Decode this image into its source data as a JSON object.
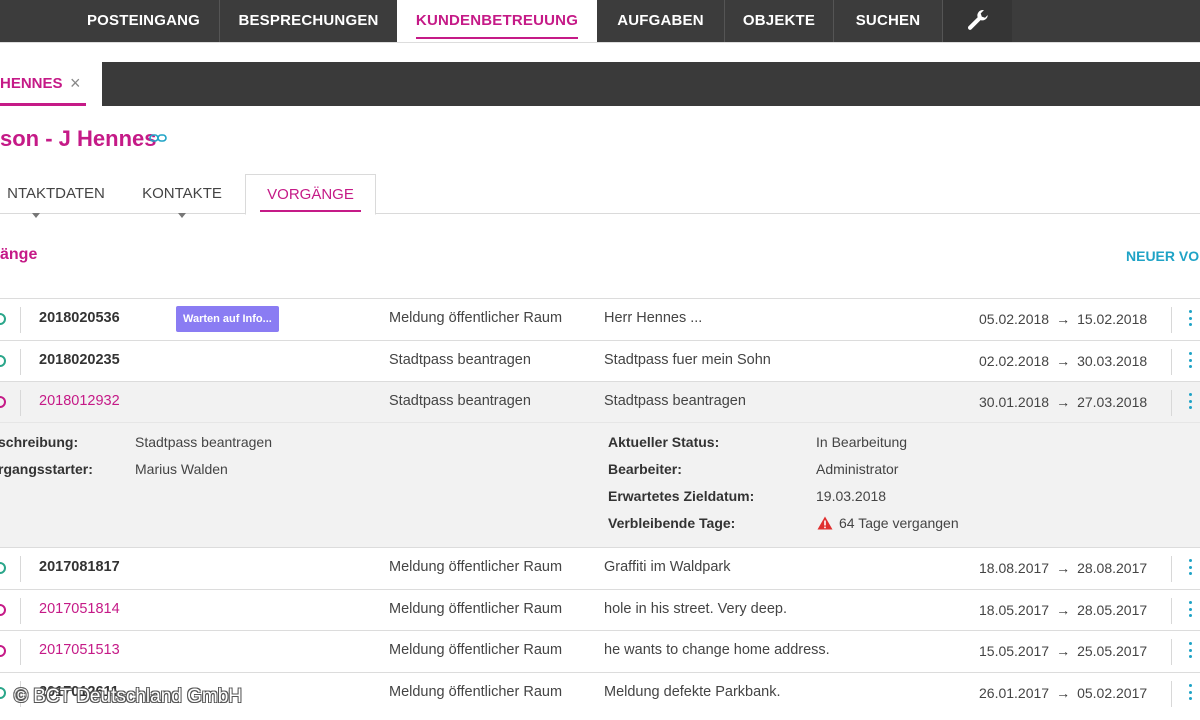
{
  "topnav": {
    "items": [
      {
        "label": "POSTEINGANG"
      },
      {
        "label": "BESPRECHUNGEN"
      },
      {
        "label": "KUNDENBETREUUNG"
      },
      {
        "label": "AUFGABEN"
      },
      {
        "label": "OBJEKTE"
      },
      {
        "label": "SUCHEN"
      }
    ],
    "tools_icon": "wrench-icon",
    "active_index": 2
  },
  "doc_tab": {
    "label": "HENNES",
    "close_symbol": "×"
  },
  "page": {
    "title": "son - J Hennes",
    "link_icon": "link-icon"
  },
  "subtabs": [
    {
      "label": "NTAKTDATEN"
    },
    {
      "label": "KONTAKTE"
    },
    {
      "label": "VORGÄNGE"
    }
  ],
  "section": {
    "heading": "änge",
    "new_button": "NEUER VO"
  },
  "rows": [
    {
      "number": "2018020536",
      "badge": "Warten auf Info...",
      "type": "Meldung öffentlicher Raum",
      "description": "Herr Hennes ...",
      "start": "05.02.2018",
      "end": "15.02.2018"
    },
    {
      "number": "2018020235",
      "type": "Stadtpass beantragen",
      "description": "Stadtpass fuer mein Sohn",
      "start": "02.02.2018",
      "end": "30.03.2018"
    },
    {
      "number": "2018012932",
      "type": "Stadtpass beantragen",
      "description": "Stadtpass beantragen",
      "start": "30.01.2018",
      "end": "27.03.2018"
    },
    {
      "number": "2017081817",
      "type": "Meldung öffentlicher Raum",
      "description": "Graffiti im Waldpark",
      "start": "18.08.2017",
      "end": "28.08.2017"
    },
    {
      "number": "2017051814",
      "type": "Meldung öffentlicher Raum",
      "description": "hole in his street. Very deep.",
      "start": "18.05.2017",
      "end": "28.05.2017"
    },
    {
      "number": "2017051513",
      "type": "Meldung öffentlicher Raum",
      "description": "he wants to change home address.",
      "start": "15.05.2017",
      "end": "25.05.2017"
    },
    {
      "number": "2017012611",
      "type": "Meldung öffentlicher Raum",
      "description": "Meldung defekte Parkbank.",
      "start": "26.01.2017",
      "end": "05.02.2017"
    }
  ],
  "arrow_symbol": "→",
  "detail": {
    "beschreibung_label": "schreibung:",
    "beschreibung_value": "Stadtpass beantragen",
    "starter_label": "rgangsstarter:",
    "starter_value": "Marius Walden",
    "status_label": "Aktueller Status:",
    "status_value": "In Bearbeitung",
    "bearbeiter_label": "Bearbeiter:",
    "bearbeiter_value": "Administrator",
    "zieldatum_label": "Erwartetes Zieldatum:",
    "zieldatum_value": "19.03.2018",
    "tage_label": "Verbleibende Tage:",
    "tage_value": "64 Tage vergangen",
    "warning_icon": "warning-triangle-icon"
  },
  "copyright": "© BCT Deutschland GmbH",
  "colors": {
    "accent": "#c51a87",
    "link": "#1fa3c6",
    "badge": "#8a7cf3",
    "nav": "#3c3c3c",
    "warning": "#e03030"
  }
}
